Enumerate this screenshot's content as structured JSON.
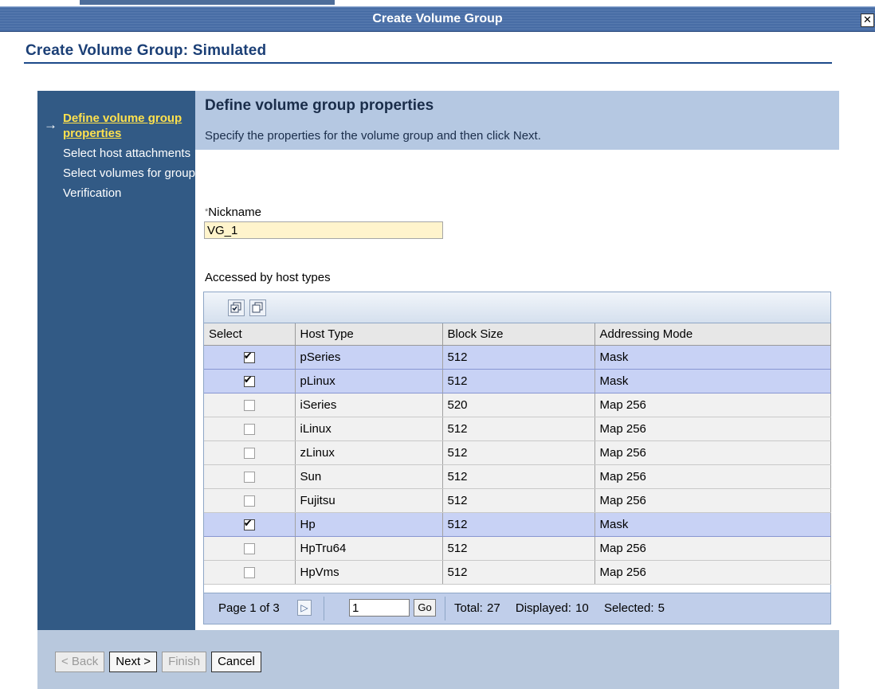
{
  "window": {
    "title": "Create Volume Group",
    "close_glyph": "✕"
  },
  "page": {
    "title": "Create Volume Group: Simulated"
  },
  "steps": [
    {
      "label": "Define volume group properties",
      "current": true
    },
    {
      "label": "Select host attachments",
      "current": false
    },
    {
      "label": "Select volumes for group",
      "current": false
    },
    {
      "label": "Verification",
      "current": false
    }
  ],
  "current_step_arrow": "→",
  "content": {
    "title": "Define volume group properties",
    "description": "Specify the properties for the volume group and then click Next."
  },
  "nickname": {
    "required_marker": "*",
    "label": "Nickname",
    "value": "VG_1"
  },
  "host_table": {
    "label": "Accessed by host types",
    "toolbar_icons": [
      "select-all-icon",
      "deselect-all-icon"
    ],
    "columns": [
      "Select",
      "Host Type",
      "Block Size",
      "Addressing Mode"
    ],
    "rows": [
      {
        "selected": true,
        "host_type": "pSeries",
        "block_size": "512",
        "addressing_mode": "Mask"
      },
      {
        "selected": true,
        "host_type": "pLinux",
        "block_size": "512",
        "addressing_mode": "Mask"
      },
      {
        "selected": false,
        "host_type": "iSeries",
        "block_size": "520",
        "addressing_mode": "Map 256"
      },
      {
        "selected": false,
        "host_type": "iLinux",
        "block_size": "512",
        "addressing_mode": "Map 256"
      },
      {
        "selected": false,
        "host_type": "zLinux",
        "block_size": "512",
        "addressing_mode": "Map 256"
      },
      {
        "selected": false,
        "host_type": "Sun",
        "block_size": "512",
        "addressing_mode": "Map 256"
      },
      {
        "selected": false,
        "host_type": "Fujitsu",
        "block_size": "512",
        "addressing_mode": "Map 256"
      },
      {
        "selected": true,
        "host_type": "Hp",
        "block_size": "512",
        "addressing_mode": "Mask"
      },
      {
        "selected": false,
        "host_type": "HpTru64",
        "block_size": "512",
        "addressing_mode": "Map 256"
      },
      {
        "selected": false,
        "host_type": "HpVms",
        "block_size": "512",
        "addressing_mode": "Map 256"
      }
    ],
    "footer": {
      "page_text": "Page 1 of 3",
      "next_page_glyph": "▷",
      "page_input_value": "1",
      "go_label": "Go",
      "total": "Total: 27",
      "displayed": "Displayed: 10",
      "selected": "Selected: 5"
    }
  },
  "buttons": {
    "back": {
      "label": "< Back",
      "disabled": true
    },
    "next": {
      "label": "Next >",
      "disabled": false
    },
    "finish": {
      "label": "Finish",
      "disabled": true
    },
    "cancel": {
      "label": "Cancel",
      "disabled": false
    }
  },
  "colors": {
    "titlebar": "#3e649f",
    "sidebar": "#325a85",
    "current_step": "#ffe14d",
    "selected_row": "#c8d2f5",
    "nickname_field": "#fff4cc"
  }
}
